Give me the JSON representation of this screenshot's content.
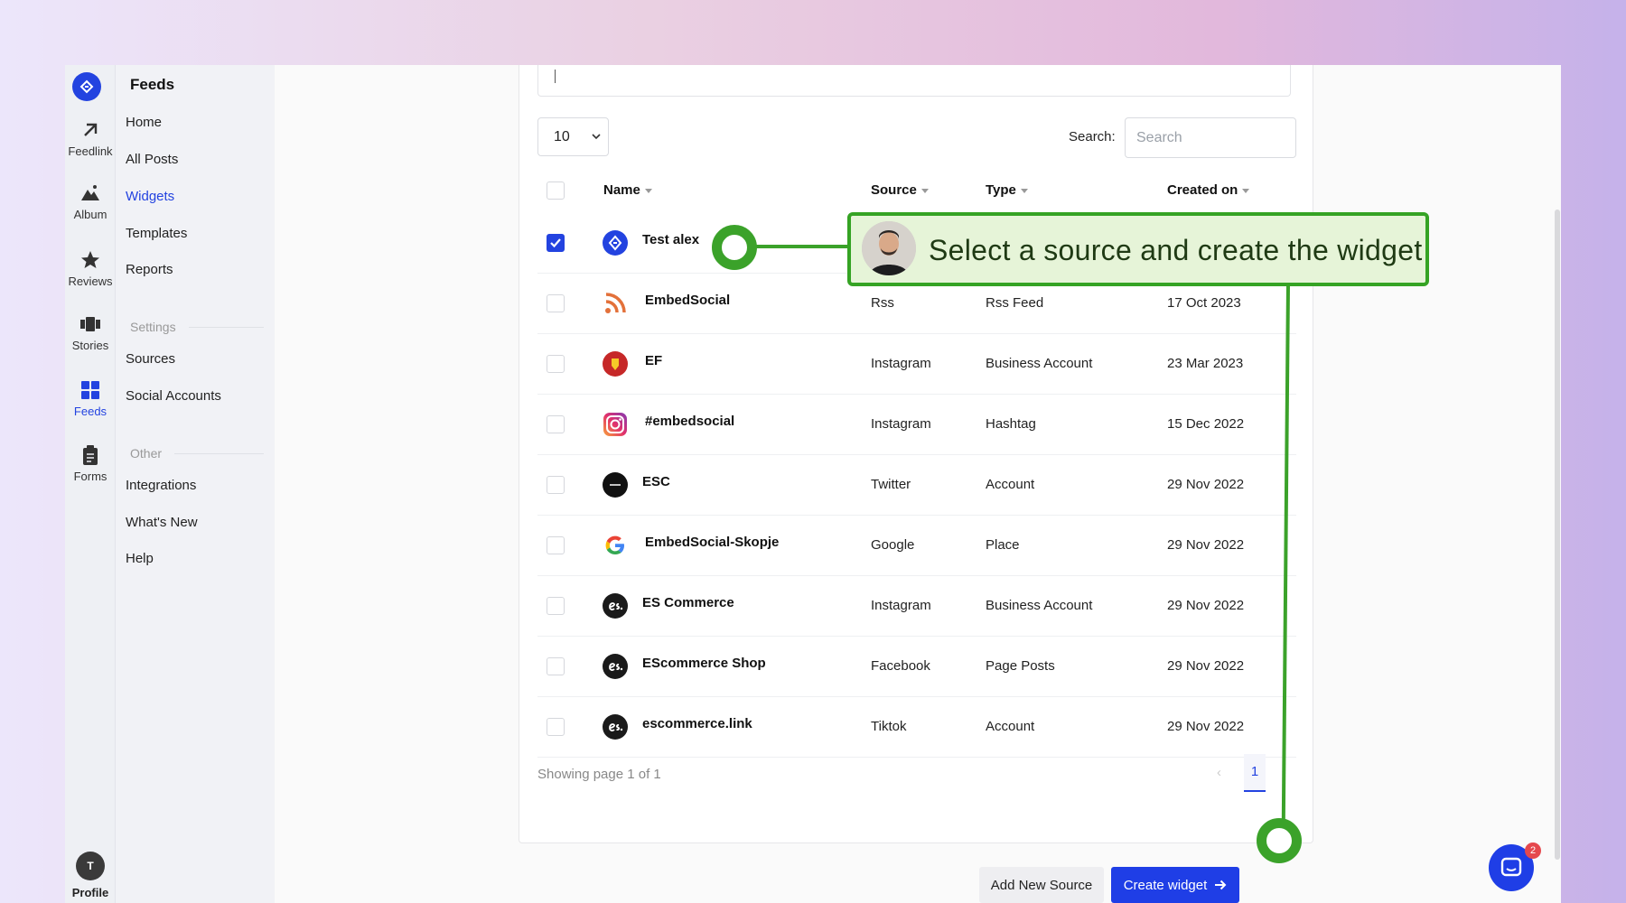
{
  "rail": {
    "items": [
      {
        "label": "Feedlink",
        "icon": "arrow-up-right-icon"
      },
      {
        "label": "Album",
        "icon": "mountain-icon"
      },
      {
        "label": "Reviews",
        "icon": "star-icon"
      },
      {
        "label": "Stories",
        "icon": "stories-icon"
      },
      {
        "label": "Feeds",
        "icon": "grid-icon"
      },
      {
        "label": "Forms",
        "icon": "clipboard-icon"
      }
    ],
    "profile_initial": "T",
    "profile_label": "Profile"
  },
  "nav": {
    "title": "Feeds",
    "items": [
      "Home",
      "All Posts",
      "Widgets",
      "Templates",
      "Reports"
    ],
    "settings_label": "Settings",
    "settings_items": [
      "Sources",
      "Social Accounts"
    ],
    "other_label": "Other",
    "other_items": [
      "Integrations",
      "What's New",
      "Help"
    ]
  },
  "controls": {
    "page_size": "10",
    "search_label": "Search:",
    "search_placeholder": "Search"
  },
  "table": {
    "headers": [
      "Name",
      "Source",
      "Type",
      "Created on"
    ],
    "rows": [
      {
        "name": "Test alex",
        "source": "",
        "type": "",
        "created": "",
        "checked": true,
        "icon": "embedsocial-logo-icon"
      },
      {
        "name": "EmbedSocial",
        "source": "Rss",
        "type": "Rss Feed",
        "created": "17 Oct 2023",
        "checked": false,
        "icon": "rss-icon"
      },
      {
        "name": "EF",
        "source": "Instagram",
        "type": "Business Account",
        "created": "23 Mar 2023",
        "checked": false,
        "icon": "ferrari-logo-icon"
      },
      {
        "name": "#embedsocial",
        "source": "Instagram",
        "type": "Hashtag",
        "created": "15 Dec 2022",
        "checked": false,
        "icon": "instagram-icon"
      },
      {
        "name": "ESC",
        "source": "Twitter",
        "type": "Account",
        "created": "29 Nov 2022",
        "checked": false,
        "icon": "esc-logo-icon"
      },
      {
        "name": "EmbedSocial-Skopje",
        "source": "Google",
        "type": "Place",
        "created": "29 Nov 2022",
        "checked": false,
        "icon": "google-icon"
      },
      {
        "name": "ES Commerce",
        "source": "Instagram",
        "type": "Business Account",
        "created": "29 Nov 2022",
        "checked": false,
        "icon": "es-logo-icon"
      },
      {
        "name": "EScommerce Shop",
        "source": "Facebook",
        "type": "Page Posts",
        "created": "29 Nov 2022",
        "checked": false,
        "icon": "es-logo-icon"
      },
      {
        "name": "escommerce.link",
        "source": "Tiktok",
        "type": "Account",
        "created": "29 Nov 2022",
        "checked": false,
        "icon": "es-logo-icon"
      }
    ]
  },
  "footer": {
    "showing": "Showing page 1 of 1",
    "prev": "‹",
    "page": "1",
    "add_source": "Add New Source",
    "create_widget": "Create widget"
  },
  "annotation": {
    "text": "Select a source and create the widget",
    "color": "#3ba22a"
  },
  "chat": {
    "badge": "2"
  },
  "colors": {
    "accent": "#2343e0",
    "annotation": "#3ba22a"
  }
}
